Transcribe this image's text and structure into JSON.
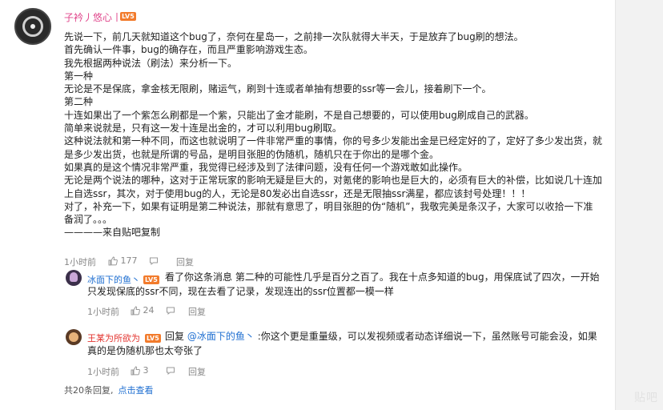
{
  "main_comment": {
    "username": "子衿丿悠心丨",
    "level": "LV5",
    "lines": [
      "先说一下，前几天就知道这个bug了，奈何在星岛一，之前排一次队就得大半天，于是放弃了bug刷的想法。",
      "首先确认一件事，bug的确存在，而且严重影响游戏生态。",
      "我先根据两种说法（刷法）来分析一下。",
      "第一种",
      "无论是不是保底，拿金核无限刷，赌运气，刷到十连或者单抽有想要的ssr等一会儿，接着刷下一个。",
      "第二种",
      "十连如果出了一个紫怎么刷都是一个紫，只能出了金才能刷，不是自己想要的，可以使用bug刷成自己的武器。",
      "简单来说就是，只有这一发十连是出金的，才可以利用bug刷取。",
      "这种说法就和第一种不同，而这也就说明了一件非常严重的事情，你的号多少发能出金是已经定好的了，定好了多少发出货，就",
      "是多少发出货，也就是所谓的号品，是明目张胆的伪随机，随机只在于你出的是哪个金。",
      "如果真的是这个情况非常严重，我觉得已经涉及到了法律问题，没有任何一个游戏敢如此操作。",
      "无论是两个说法的哪种，这对于正常玩家的影响无疑是巨大的，对氪佬的影响也是巨大的，必须有巨大的补偿，比如说几十连加",
      "上自选ssr，其次，对于使用bug的人，无论是80发必出自选ssr，还是无限抽ssr满星，都应该封号处理！！！",
      "对了，补充一下，如果有证明是第二种说法，那就有意思了，明目张胆的伪“随机”，我敬完美是条汉子，大家可以收拾一下准",
      "备润了。。。",
      "————来自贴吧复制"
    ],
    "time": "1小时前",
    "likes": "177",
    "reply_label": "回复"
  },
  "reply1": {
    "username": "冰面下的鱼丶",
    "level": "LV5",
    "lines": [
      "看了你这条消息 第二种的可能性几乎是百分之百了。我在十点多知道的bug，用保底试了四次，一开始",
      "只发现保底的ssr不同，现在去看了记录，发现连出的ssr位置都一模一样"
    ],
    "time": "1小时前",
    "likes": "24",
    "reply_label": "回复"
  },
  "reply2": {
    "username": "王某为所欲为",
    "level": "LV5",
    "reply_word": "回复",
    "mention": "@冰面下的鱼丶",
    "lines": [
      ":你这个更是重量级，可以发视频或者动态详细说一下，虽然账号可能会没，如果",
      "真的是伪随机那也太夸张了"
    ],
    "time": "1小时前",
    "likes": "3",
    "reply_label": "回复"
  },
  "footer": {
    "total": "共20条回复,",
    "expand": "点击查看"
  },
  "watermark": "贴吧",
  "colors": {
    "username_pink": "#e0478c",
    "link_blue": "#1f6fd1",
    "level_orange": "#f27b2c"
  }
}
